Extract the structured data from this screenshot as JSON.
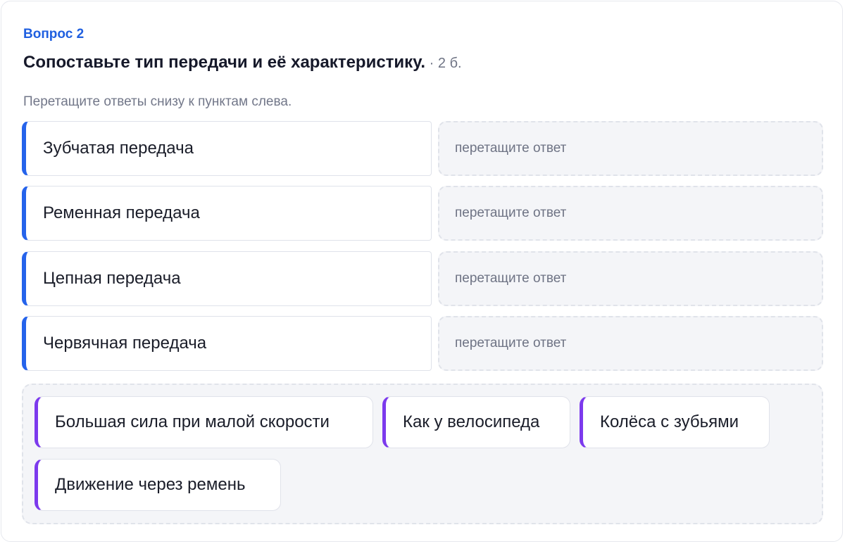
{
  "question": {
    "number_label": "Вопрос 2",
    "title": "Сопоставьте тип передачи и её характеристику.",
    "points": " · 2 б.",
    "hint": "Перетащите ответы снизу к пунктам слева."
  },
  "terms": [
    {
      "label": "Зубчатая передача",
      "drop_placeholder": "перетащите ответ"
    },
    {
      "label": "Ременная передача",
      "drop_placeholder": "перетащите ответ"
    },
    {
      "label": "Цепная передача",
      "drop_placeholder": "перетащите ответ"
    },
    {
      "label": "Червячная передача",
      "drop_placeholder": "перетащите ответ"
    }
  ],
  "answers": [
    {
      "label": "Большая сила при малой скорости"
    },
    {
      "label": "Как у велосипеда"
    },
    {
      "label": "Колёса с зубьями"
    },
    {
      "label": "Движение через ремень"
    }
  ],
  "colors": {
    "accent_blue": "#2563eb",
    "accent_purple": "#7c3aed",
    "question_number": "#1f5fe0"
  }
}
